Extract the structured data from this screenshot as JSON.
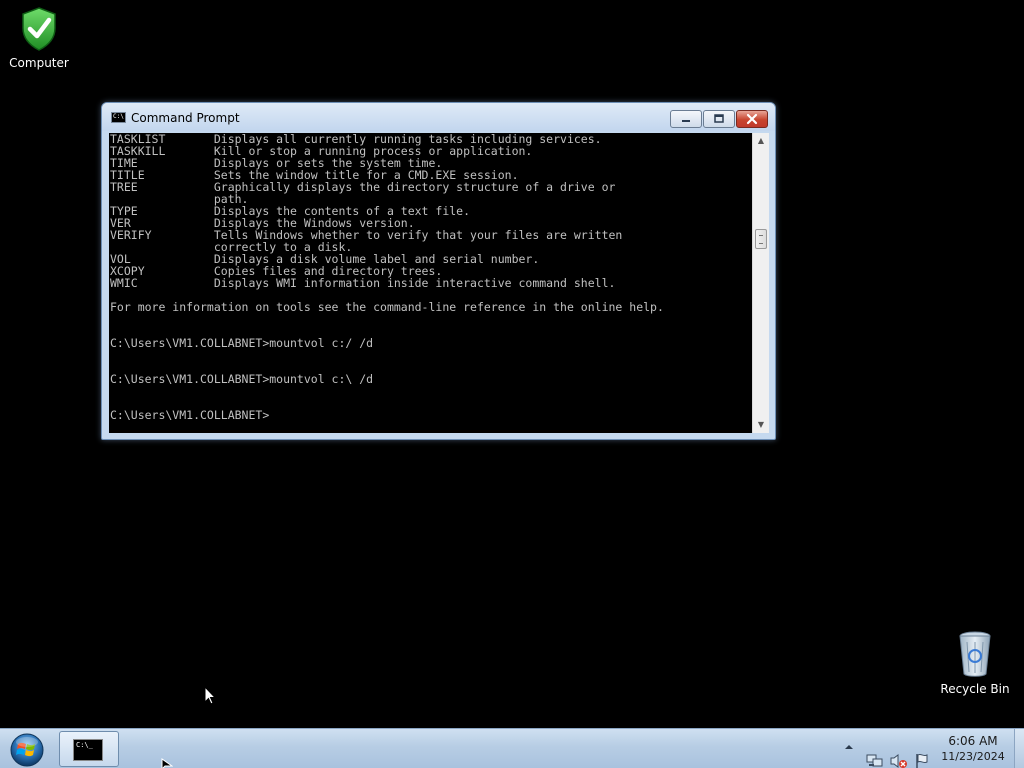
{
  "desktop": {
    "icons": [
      {
        "label": "Computer",
        "icon": "computer-shield-icon"
      },
      {
        "label": "Recycle Bin",
        "icon": "recycle-bin-icon"
      }
    ]
  },
  "window": {
    "title": "Command Prompt",
    "icon": "cmd-icon",
    "title_icon_text": "C:\\",
    "buttons": [
      "minimize",
      "maximize",
      "close"
    ],
    "console_lines": [
      "TASKLIST       Displays all currently running tasks including services.",
      "TASKKILL       Kill or stop a running process or application.",
      "TIME           Displays or sets the system time.",
      "TITLE          Sets the window title for a CMD.EXE session.",
      "TREE           Graphically displays the directory structure of a drive or",
      "               path.",
      "TYPE           Displays the contents of a text file.",
      "VER            Displays the Windows version.",
      "VERIFY         Tells Windows whether to verify that your files are written",
      "               correctly to a disk.",
      "VOL            Displays a disk volume label and serial number.",
      "XCOPY          Copies files and directory trees.",
      "WMIC           Displays WMI information inside interactive command shell.",
      "",
      "For more information on tools see the command-line reference in the online help.",
      "",
      "",
      "C:\\Users\\VM1.COLLABNET>mountvol c:/ /d",
      "",
      "",
      "C:\\Users\\VM1.COLLABNET>mountvol c:\\ /d",
      "",
      "",
      "C:\\Users\\VM1.COLLABNET>"
    ]
  },
  "taskbar": {
    "start_icon": "windows-orb-icon",
    "tasks": [
      {
        "name": "Command Prompt",
        "icon": "cmd-icon",
        "icon_text": "C:\\_"
      }
    ],
    "tray_icons": [
      "show-hidden-icons-arrow",
      "network-icon",
      "volume-muted-icon",
      "action-center-flag-icon"
    ],
    "clock": {
      "time": "6:06 AM",
      "date": "11/23/2024"
    }
  },
  "colors": {
    "console_bg": "#000000",
    "console_fg": "#c0c0c0",
    "taskbar": "#b7cde4",
    "close_button": "#c8452f"
  }
}
